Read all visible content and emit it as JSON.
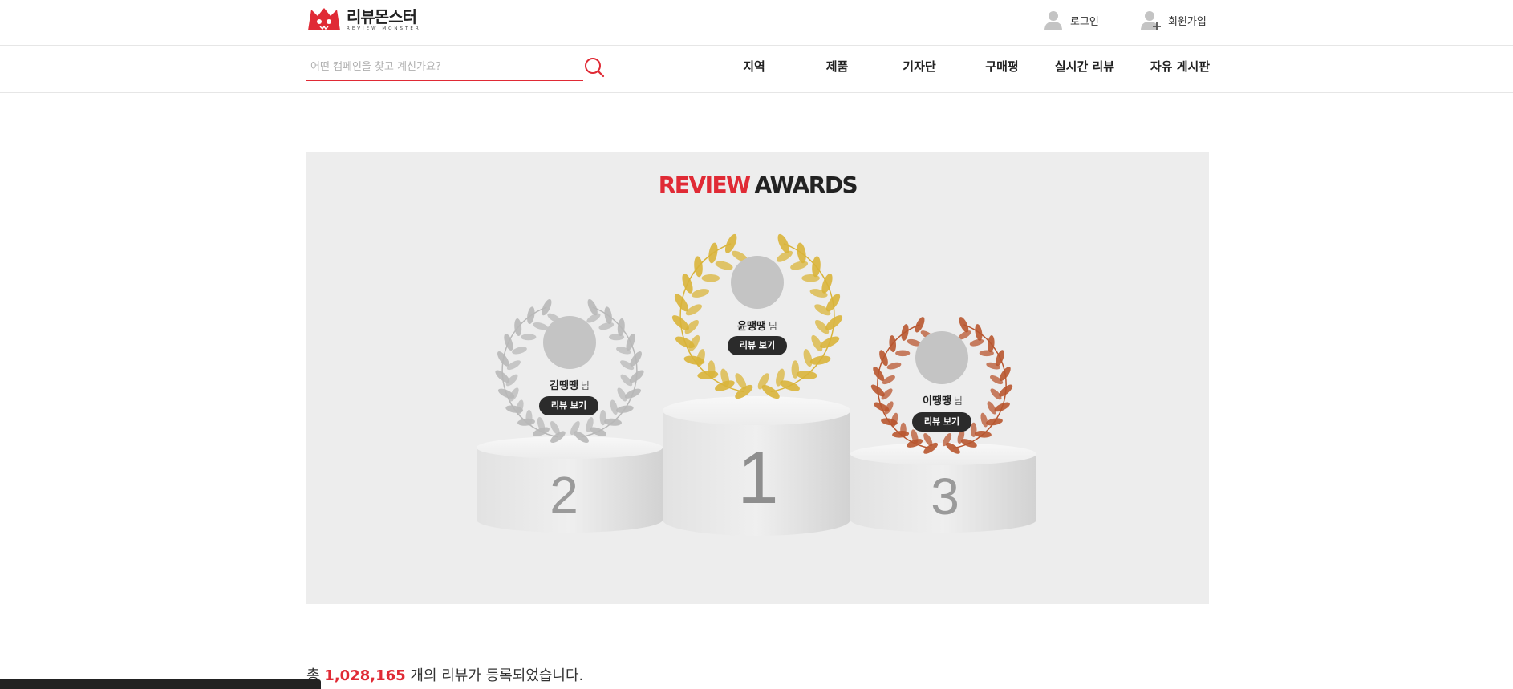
{
  "header": {
    "logo_ko": "리뷰몬스터",
    "logo_en": "REVIEW MONSTER",
    "login_label": "로그인",
    "signup_label": "회원가입"
  },
  "search": {
    "placeholder": "어떤 캠페인을 찾고 계신가요?",
    "value": ""
  },
  "nav": {
    "items": [
      "지역",
      "제품",
      "기자단",
      "구매평",
      "실시간 리뷰",
      "자유 게시판"
    ]
  },
  "awards": {
    "title_red": "REVIEW",
    "title_dark": "AWARDS",
    "honorific": "님",
    "button_label": "리뷰 보기",
    "winners": {
      "first": {
        "rank": "1",
        "name": "윤땡땡",
        "wreath": "gold"
      },
      "second": {
        "rank": "2",
        "name": "김땡땡",
        "wreath": "silver"
      },
      "third": {
        "rank": "3",
        "name": "이땡땡",
        "wreath": "bronze"
      }
    }
  },
  "summary": {
    "prefix": "총",
    "count": "1,028,165",
    "suffix": "개의 리뷰가 등록되었습니다."
  },
  "colors": {
    "accent": "#e02a35",
    "gold": "#d9b43a",
    "silver": "#b8b8b8",
    "bronze": "#b8562f",
    "panel": "#ededed"
  }
}
